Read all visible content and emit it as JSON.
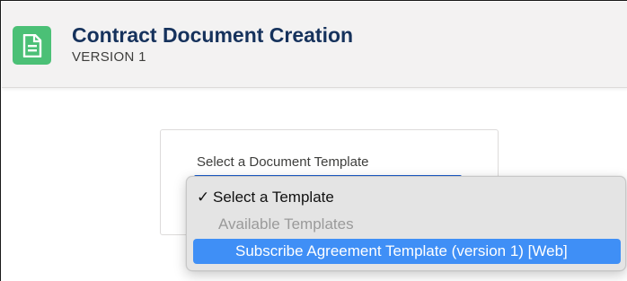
{
  "header": {
    "title": "Contract Document Creation",
    "subtitle": "VERSION 1",
    "icon": "document-icon",
    "icon_color": "#4bc076"
  },
  "form": {
    "field_label": "Select a Document Template",
    "select_accent": "#1b5fd1"
  },
  "dropdown": {
    "selected_option": "Select a Template",
    "group_label": "Available Templates",
    "highlighted_option": "Subscribe Agreement Template (version 1) [Web]",
    "highlight_color": "#3f8ff6"
  }
}
